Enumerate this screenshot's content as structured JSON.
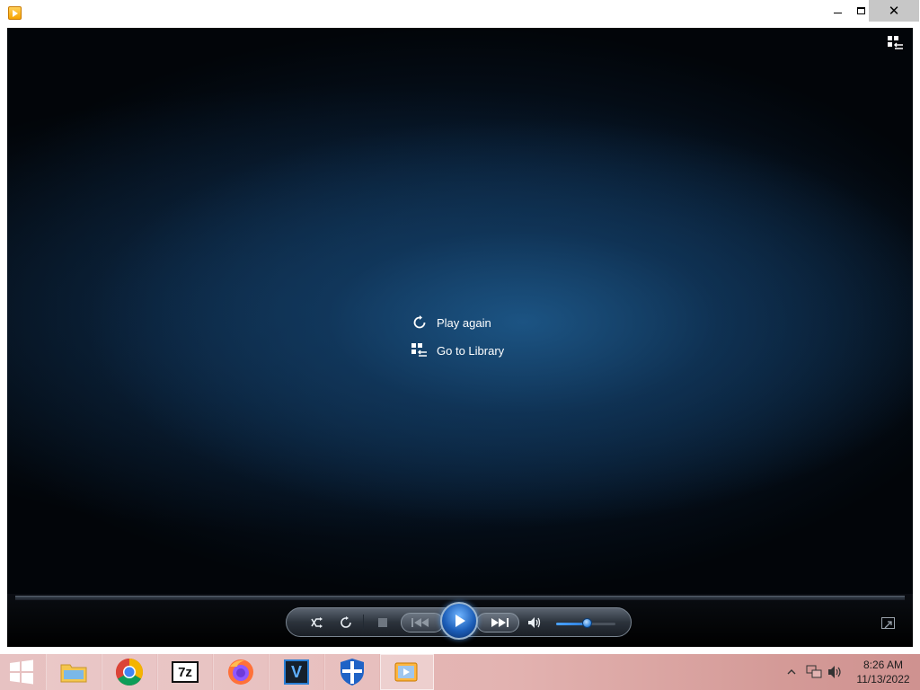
{
  "window": {
    "title": "",
    "buttons": {
      "minimize": "minimize",
      "maximize": "maximize",
      "close": "✕"
    }
  },
  "overlay_menu": {
    "play_again": "Play again",
    "go_to_library": "Go to Library"
  },
  "controls": {
    "shuffle": "shuffle-icon",
    "repeat": "repeat-icon",
    "stop": "stop-icon",
    "previous": "previous-icon",
    "play": "play-icon",
    "next": "next-icon",
    "mute": "speaker-icon",
    "volume_level": 0.5,
    "seek_position": 0.0
  },
  "taskbar": {
    "apps": [
      {
        "name": "file-explorer",
        "icon": "folder-icon"
      },
      {
        "name": "chrome",
        "icon": "chrome-icon"
      },
      {
        "name": "7-zip",
        "label": "7z"
      },
      {
        "name": "firefox",
        "icon": "firefox-icon"
      },
      {
        "name": "v-app",
        "label": "V"
      },
      {
        "name": "security",
        "icon": "shield-icon"
      },
      {
        "name": "media-player",
        "icon": "media-player-icon",
        "active": true
      }
    ],
    "clock": {
      "time": "8:26 AM",
      "date": "11/13/2022"
    }
  },
  "colors": {
    "accent_blue": "#2c7fd9",
    "taskbar": "#e3b3b1",
    "video_bg": "#061424"
  }
}
